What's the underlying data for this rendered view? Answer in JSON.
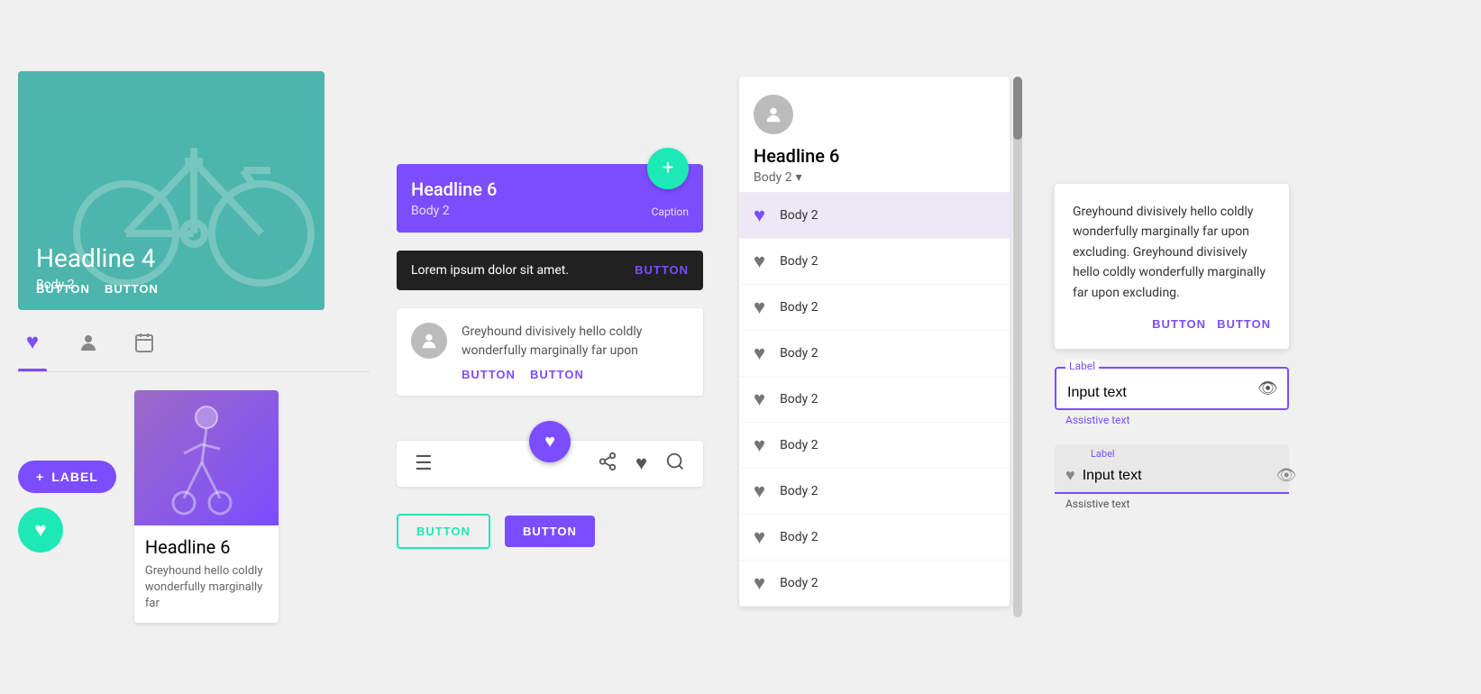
{
  "colors": {
    "purple": "#7c4dff",
    "teal": "#1de9b6",
    "dark": "#212121",
    "light_purple_bg": "#ede7f6",
    "avatar_bg": "#bdbdbd",
    "scrollbar": "#9e9e9e"
  },
  "col1": {
    "card": {
      "headline": "Headline 4",
      "body": "Body 2",
      "button1": "BUTTON",
      "button2": "BUTTON"
    },
    "tabs": [
      {
        "icon": "♥",
        "label": "tab-heart",
        "active": true
      },
      {
        "icon": "👤",
        "label": "tab-person"
      },
      {
        "icon": "📅",
        "label": "tab-calendar"
      }
    ],
    "fab_label": "LABEL",
    "fab_plus": "+",
    "heart_fab": "♥",
    "small_card": {
      "headline": "Headline 6",
      "body": "Greyhound hello coldly wonderfully marginally far"
    }
  },
  "col2": {
    "banner": {
      "headline": "Headline 6",
      "body2": "Body 2",
      "caption": "Caption",
      "fab_plus": "+"
    },
    "snackbar": {
      "text": "Lorem ipsum dolor sit amet.",
      "button": "BUTTON"
    },
    "list_item": {
      "body_text": "Greyhound divisively hello coldly wonderfully marginally far upon",
      "button1": "BUTTON",
      "button2": "BUTTON"
    },
    "bottom_bar": {
      "fab_heart": "♥",
      "icon_menu": "☰",
      "icon_share": "⤴",
      "icon_heart": "♥",
      "icon_search": "🔍"
    },
    "buttons": {
      "outline": "BUTTON",
      "filled": "BUTTON"
    }
  },
  "col3": {
    "header": {
      "headline": "Headline 6",
      "body2": "Body 2",
      "dropdown_arrow": "▾"
    },
    "items": [
      {
        "text": "Body 2",
        "selected": true
      },
      {
        "text": "Body 2",
        "selected": false
      },
      {
        "text": "Body 2",
        "selected": false
      },
      {
        "text": "Body 2",
        "selected": false
      },
      {
        "text": "Body 2",
        "selected": false
      },
      {
        "text": "Body 2",
        "selected": false
      },
      {
        "text": "Body 2",
        "selected": false
      },
      {
        "text": "Body 2",
        "selected": false
      },
      {
        "text": "Body 2",
        "selected": false
      }
    ]
  },
  "col4": {
    "dialog": {
      "text": "Greyhound divisively hello coldly wonderfully marginally far upon excluding. Greyhound divisively hello coldly wonderfully marginally far upon excluding.",
      "button1": "BUTTON",
      "button2": "BUTTON"
    },
    "input_outlined": {
      "label": "Label",
      "value": "Input text",
      "assistive": "Assistive text",
      "eye_icon": "👁"
    },
    "input_filled": {
      "label": "Label",
      "value": "Input text",
      "assistive": "Assistive text",
      "heart_icon": "♥",
      "eye_icon": "👁"
    }
  }
}
